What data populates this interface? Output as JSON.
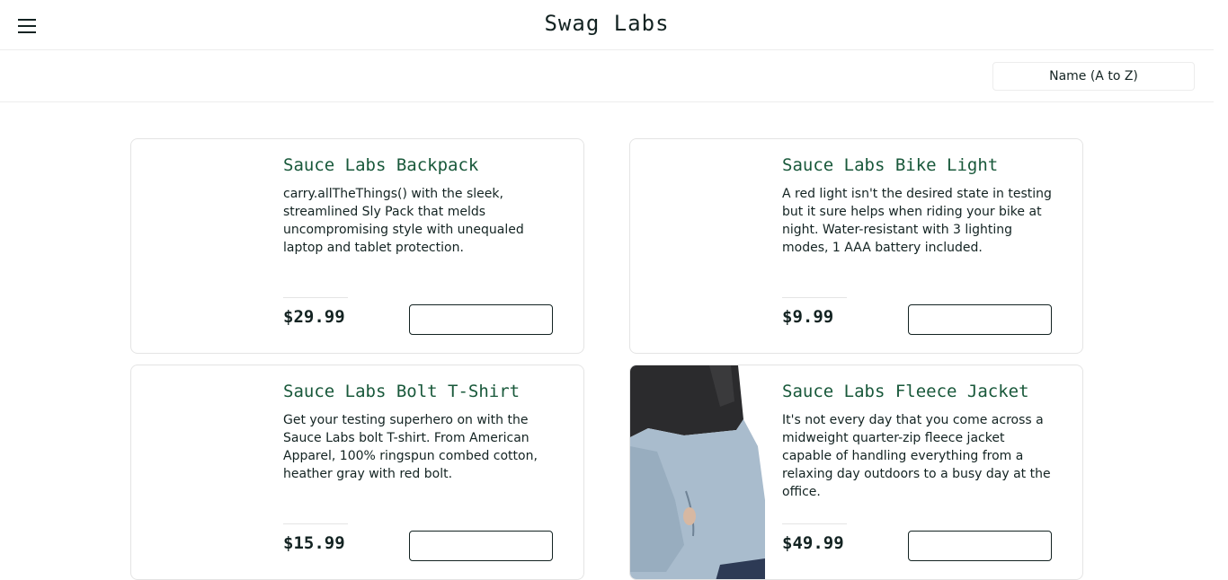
{
  "app": {
    "title": "Swag Labs"
  },
  "header": {
    "menu_icon": "hamburger-menu-icon"
  },
  "sort": {
    "selected": "Name (A to Z)"
  },
  "products": [
    {
      "name": "Sauce Labs Backpack",
      "description": "carry.allTheThings() with the sleek, streamlined Sly Pack that melds uncompromising style with unequaled laptop and tablet protection.",
      "price": "$29.99",
      "button_label": ""
    },
    {
      "name": "Sauce Labs Bike Light",
      "description": "A red light isn't the desired state in testing but it sure helps when riding your bike at night. Water-resistant with 3 lighting modes, 1 AAA battery included.",
      "price": "$9.99",
      "button_label": ""
    },
    {
      "name": "Sauce Labs Bolt T-Shirt",
      "description": "Get your testing superhero on with the Sauce Labs bolt T-shirt. From American Apparel, 100% ringspun combed cotton, heather gray with red bolt.",
      "price": "$15.99",
      "button_label": ""
    },
    {
      "name": "Sauce Labs Fleece Jacket",
      "description": "It's not every day that you come across a midweight quarter-zip fleece jacket capable of handling everything from a relaxing day outdoors to a busy day at the office.",
      "price": "$49.99",
      "button_label": ""
    }
  ],
  "colors": {
    "product_name": "#18583a",
    "text": "#132322",
    "border": "#e4e4e4"
  }
}
